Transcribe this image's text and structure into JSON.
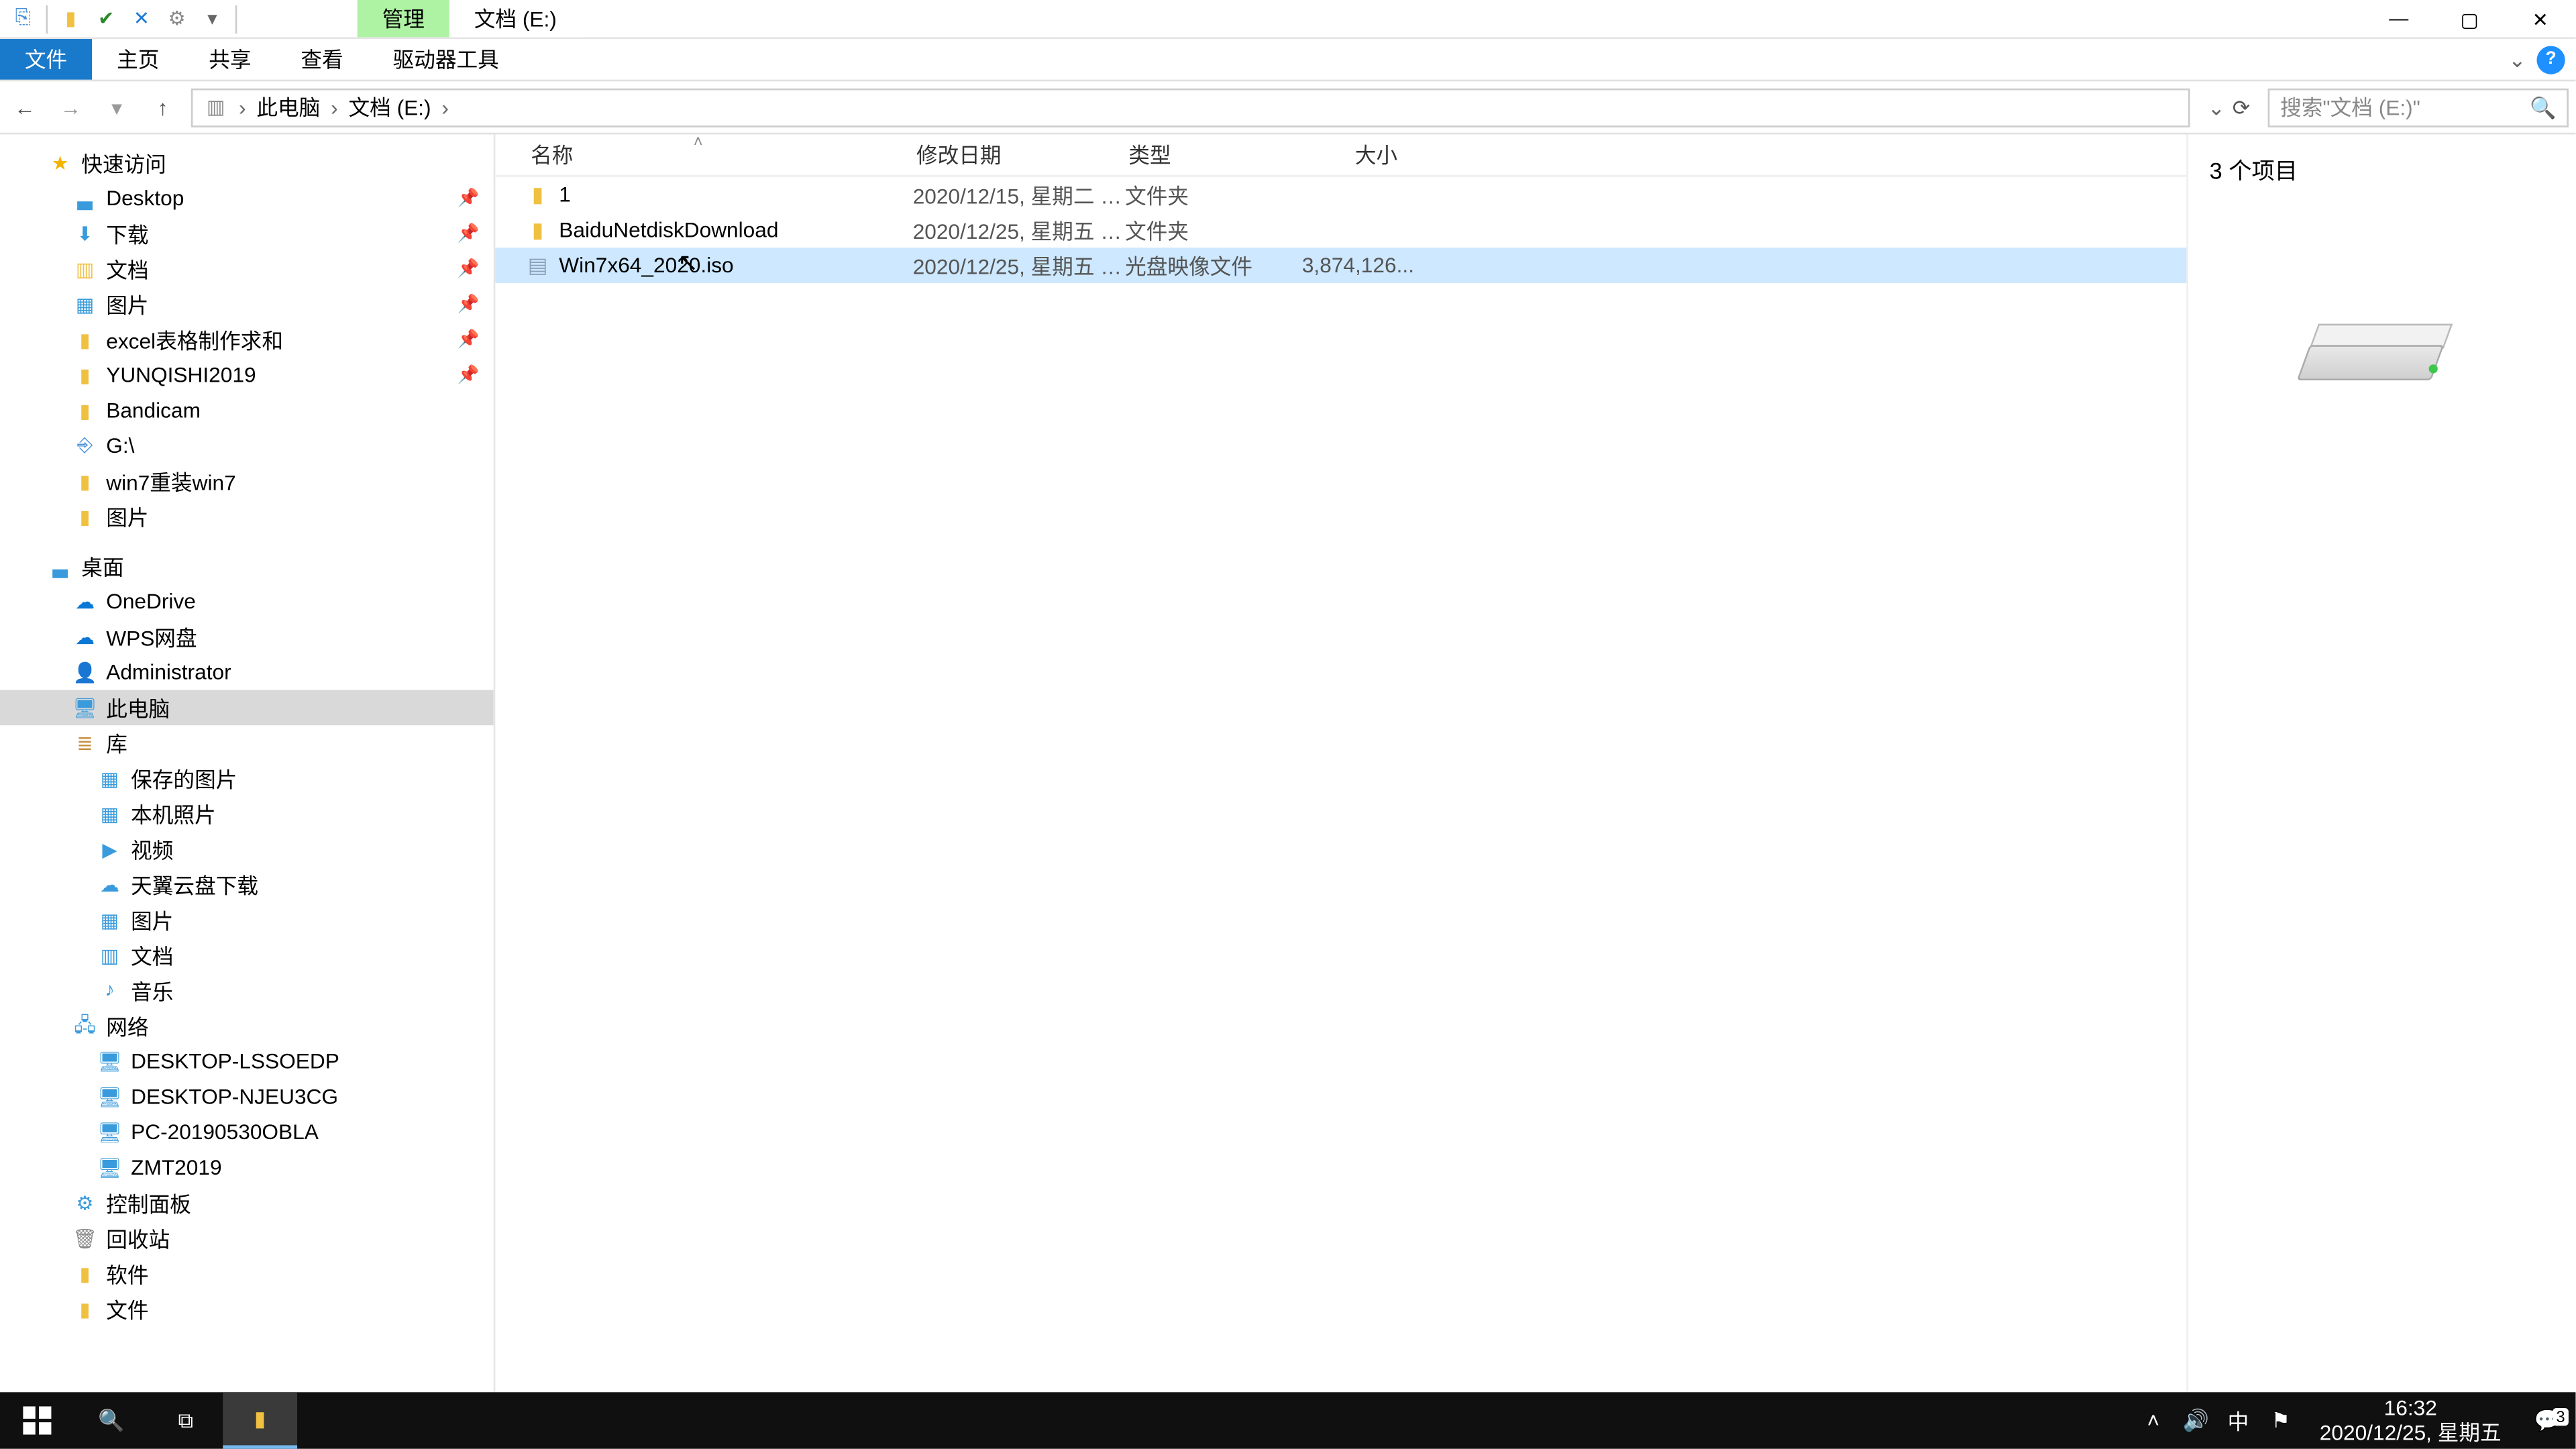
{
  "titlebar": {
    "manage_tab": "管理",
    "title": "文档 (E:)"
  },
  "ribbon": {
    "file": "文件",
    "home": "主页",
    "share": "共享",
    "view": "查看",
    "drive_tools": "驱动器工具"
  },
  "breadcrumb": {
    "root": "此电脑",
    "loc": "文档 (E:)"
  },
  "search": {
    "placeholder": "搜索\"文档 (E:)\""
  },
  "nav": {
    "quick_access": "快速访问",
    "desktop": "Desktop",
    "downloads": "下载",
    "documents": "文档",
    "pictures": "图片",
    "excel": "excel表格制作求和",
    "yunqi": "YUNQISHI2019",
    "bandicam": "Bandicam",
    "g_drive": "G:\\",
    "win7": "win7重装win7",
    "pictures2": "图片",
    "desktop_zh": "桌面",
    "onedrive": "OneDrive",
    "wps": "WPS网盘",
    "admin": "Administrator",
    "this_pc": "此电脑",
    "library": "库",
    "saved_pics": "保存的图片",
    "camera_roll": "本机照片",
    "videos": "视频",
    "tianyi": "天翼云盘下载",
    "lib_pics": "图片",
    "lib_docs": "文档",
    "music": "音乐",
    "network": "网络",
    "pc1": "DESKTOP-LSSOEDP",
    "pc2": "DESKTOP-NJEU3CG",
    "pc3": "PC-20190530OBLA",
    "pc4": "ZMT2019",
    "control_panel": "控制面板",
    "recycle": "回收站",
    "software": "软件",
    "files": "文件"
  },
  "columns": {
    "name": "名称",
    "date": "修改日期",
    "type": "类型",
    "size": "大小"
  },
  "files": [
    {
      "name": "1",
      "date": "2020/12/15, 星期二 1...",
      "type": "文件夹",
      "size": "",
      "icon": "folder"
    },
    {
      "name": "BaiduNetdiskDownload",
      "date": "2020/12/25, 星期五 1...",
      "type": "文件夹",
      "size": "",
      "icon": "folder"
    },
    {
      "name": "Win7x64_2020.iso",
      "date": "2020/12/25, 星期五 1...",
      "type": "光盘映像文件",
      "size": "3,874,126...",
      "icon": "file",
      "selected": true
    }
  ],
  "preview": {
    "count": "3 个项目"
  },
  "status": {
    "text": "3 个项目"
  },
  "taskbar": {
    "time": "16:32",
    "date": "2020/12/25, 星期五",
    "ime": "中",
    "notif_count": "3"
  }
}
